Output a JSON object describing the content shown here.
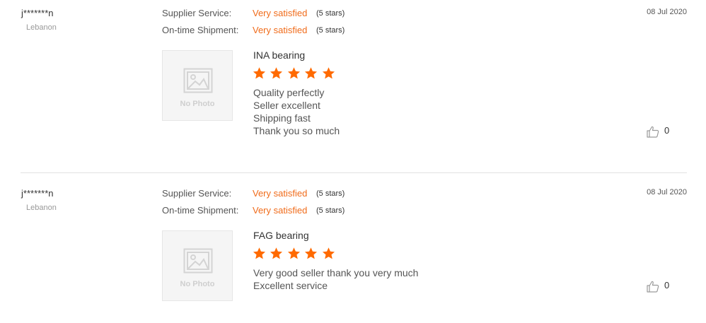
{
  "reviews": [
    {
      "user": "j*******n",
      "country": "Lebanon",
      "date": "08 Jul 2020",
      "ratings": [
        {
          "label": "Supplier Service:",
          "value": "Very satisfied",
          "stars": "(5 stars)"
        },
        {
          "label": "On-time Shipment:",
          "value": "Very satisfied",
          "stars": "(5 stars)"
        }
      ],
      "photo_placeholder": "No Photo",
      "product": "INA bearing",
      "star_rating": 5,
      "comment_lines": [
        "Quality perfectly",
        "Seller excellent",
        "Shipping fast",
        "Thank you so much"
      ],
      "likes": "0"
    },
    {
      "user": "j*******n",
      "country": "Lebanon",
      "date": "08 Jul 2020",
      "ratings": [
        {
          "label": "Supplier Service:",
          "value": "Very satisfied",
          "stars": "(5 stars)"
        },
        {
          "label": "On-time Shipment:",
          "value": "Very satisfied",
          "stars": "(5 stars)"
        }
      ],
      "photo_placeholder": "No Photo",
      "product": "FAG bearing",
      "star_rating": 5,
      "comment_lines": [
        "Very good seller thank you very much",
        "Excellent service"
      ],
      "likes": "0"
    }
  ],
  "colors": {
    "accent": "#f06b1a",
    "star": "#ff6a00",
    "divider": "#e2e2e2"
  },
  "icons": {
    "like": "thumbs-up-icon",
    "photo": "image-placeholder-icon",
    "star": "star-icon"
  }
}
